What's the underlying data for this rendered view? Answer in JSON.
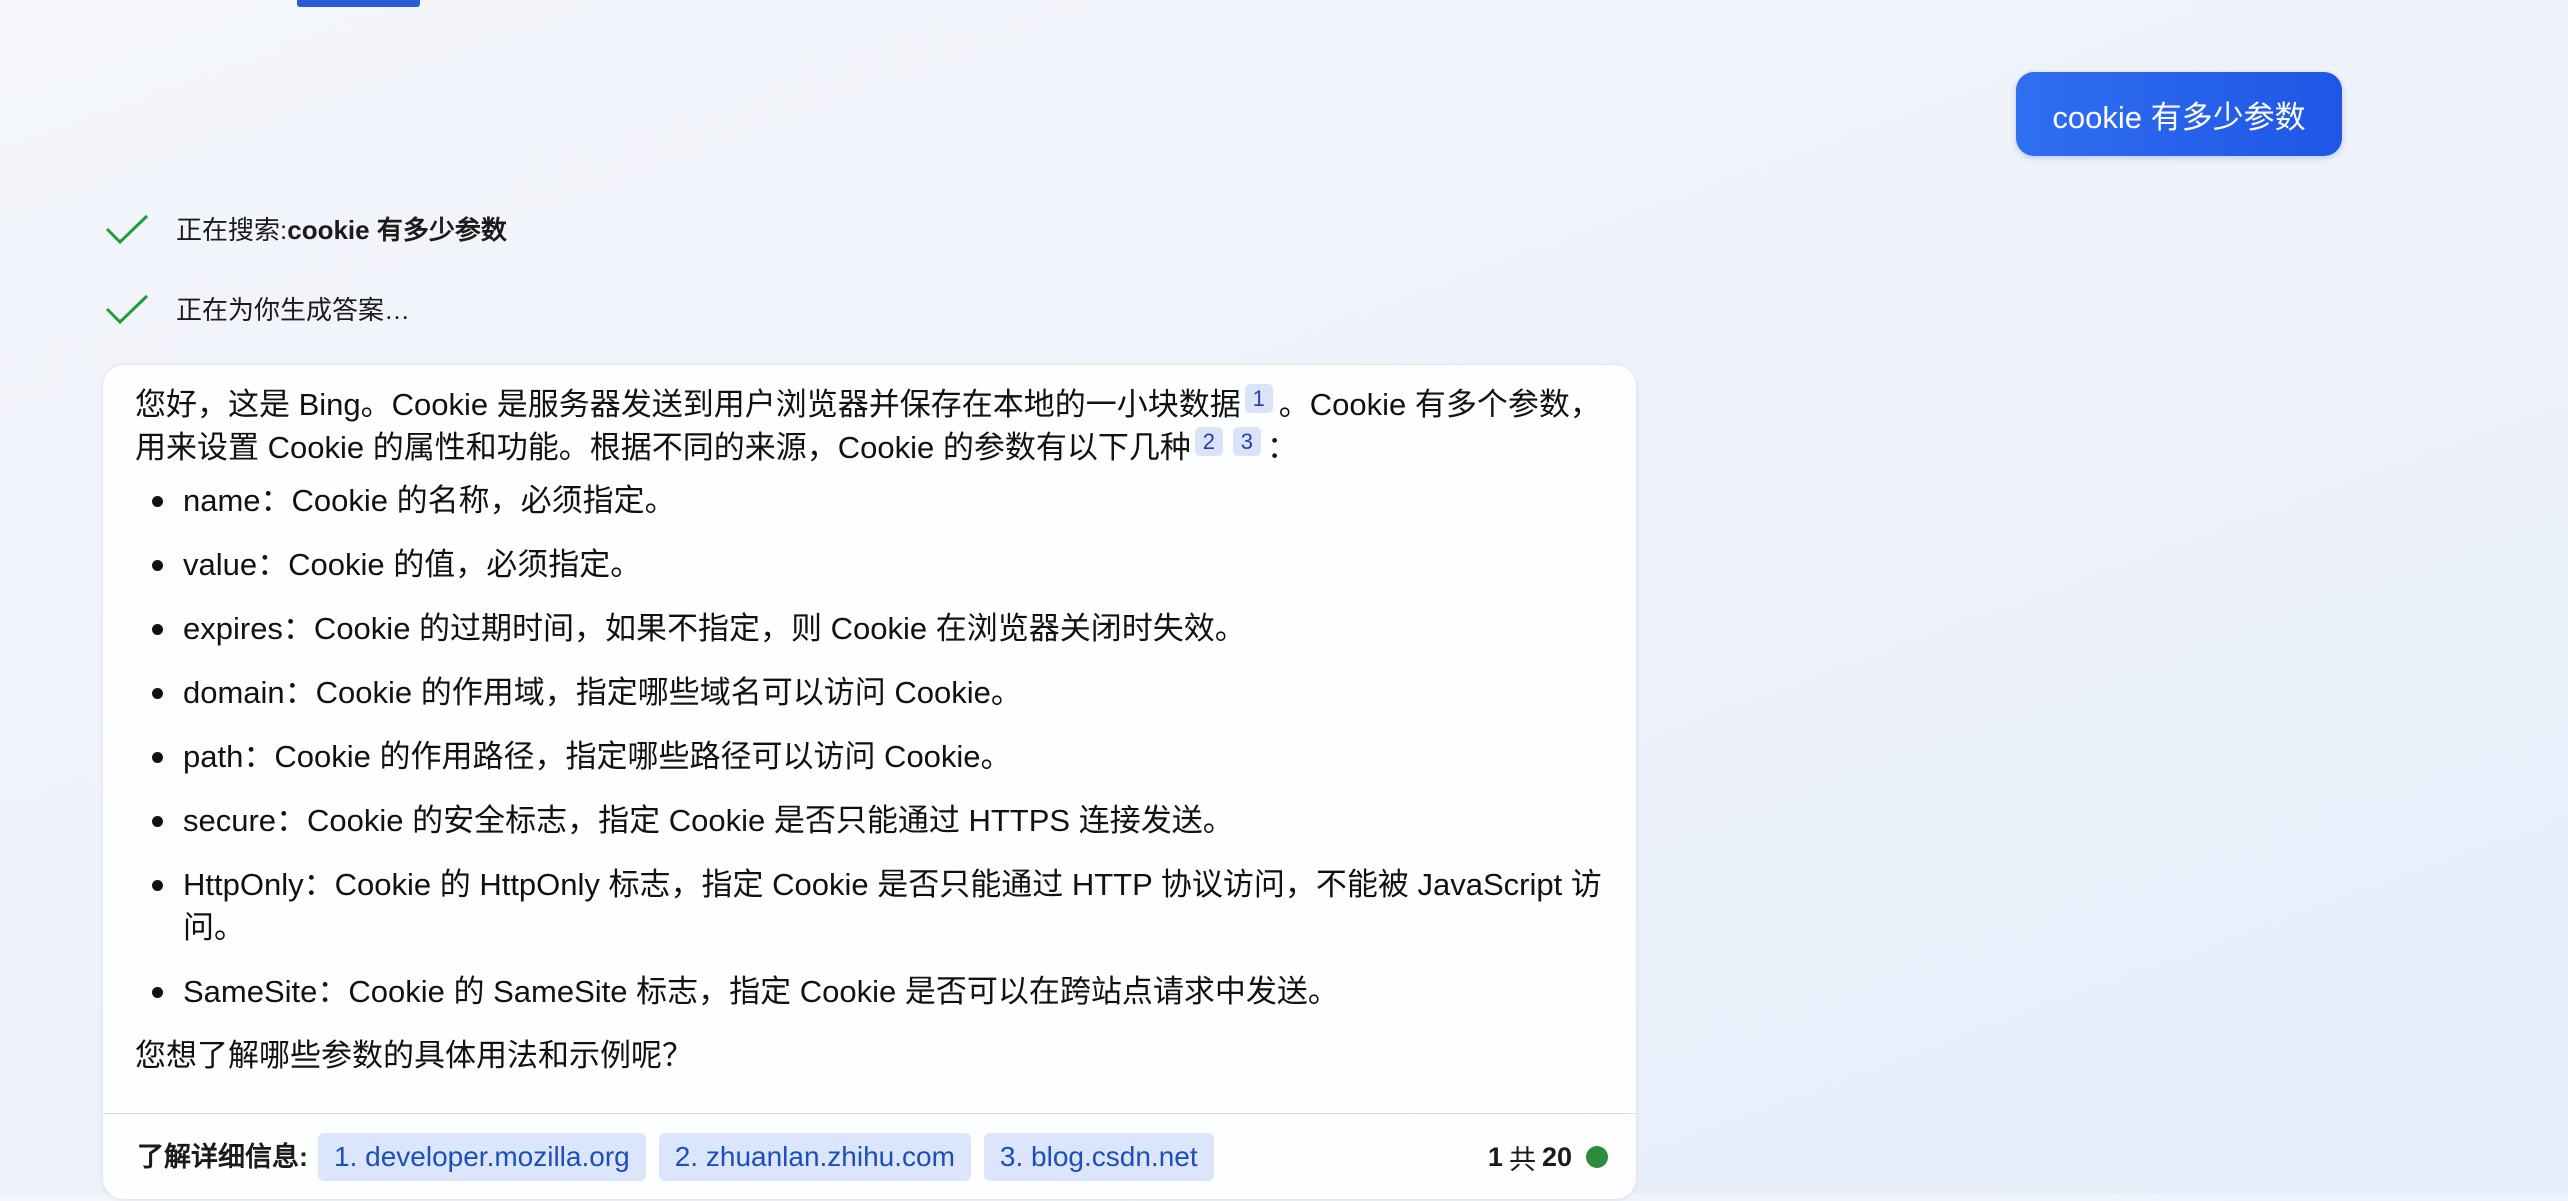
{
  "user_message": "cookie 有多少参数",
  "progress": [
    {
      "prefix": "正在搜索: ",
      "query": "cookie 有多少参数"
    },
    {
      "prefix": "正在为你生成答案…",
      "query": ""
    }
  ],
  "answer": {
    "intro_part1": "您好，这是 Bing。Cookie 是服务器发送到用户浏览器并保存在本地的一小块数据",
    "cite1": "1",
    "intro_part2": "。Cookie 有多个参数，用来设置 Cookie 的属性和功能。根据不同的来源，Cookie 的参数有以下几种",
    "cite2": "2",
    "cite3": "3",
    "intro_part3": "：",
    "params": [
      "name：Cookie 的名称，必须指定。",
      "value：Cookie 的值，必须指定。",
      "expires：Cookie 的过期时间，如果不指定，则 Cookie 在浏览器关闭时失效。",
      "domain：Cookie 的作用域，指定哪些域名可以访问 Cookie。",
      "path：Cookie 的作用路径，指定哪些路径可以访问 Cookie。",
      "secure：Cookie 的安全标志，指定 Cookie 是否只能通过 HTTPS 连接发送。",
      "HttpOnly：Cookie 的 HttpOnly 标志，指定 Cookie 是否只能通过 HTTP 协议访问，不能被 JavaScript 访问。",
      "SameSite：Cookie 的 SameSite 标志，指定 Cookie 是否可以在跨站点请求中发送。"
    ],
    "outro": "您想了解哪些参数的具体用法和示例呢？"
  },
  "footer": {
    "label": "了解详细信息:",
    "sources": [
      "1. developer.mozilla.org",
      "2. zhuanlan.zhihu.com",
      "3. blog.csdn.net"
    ],
    "turn_current": "1",
    "turn_sep": "共",
    "turn_total": "20",
    "status_color": "#2e8b3a"
  },
  "colors": {
    "accent": "#2a5bd7",
    "check": "#1f9d3a",
    "cite_bg": "#dbe3f8",
    "chip_bg": "#dbe5fb",
    "chip_text": "#1d4fb8"
  }
}
